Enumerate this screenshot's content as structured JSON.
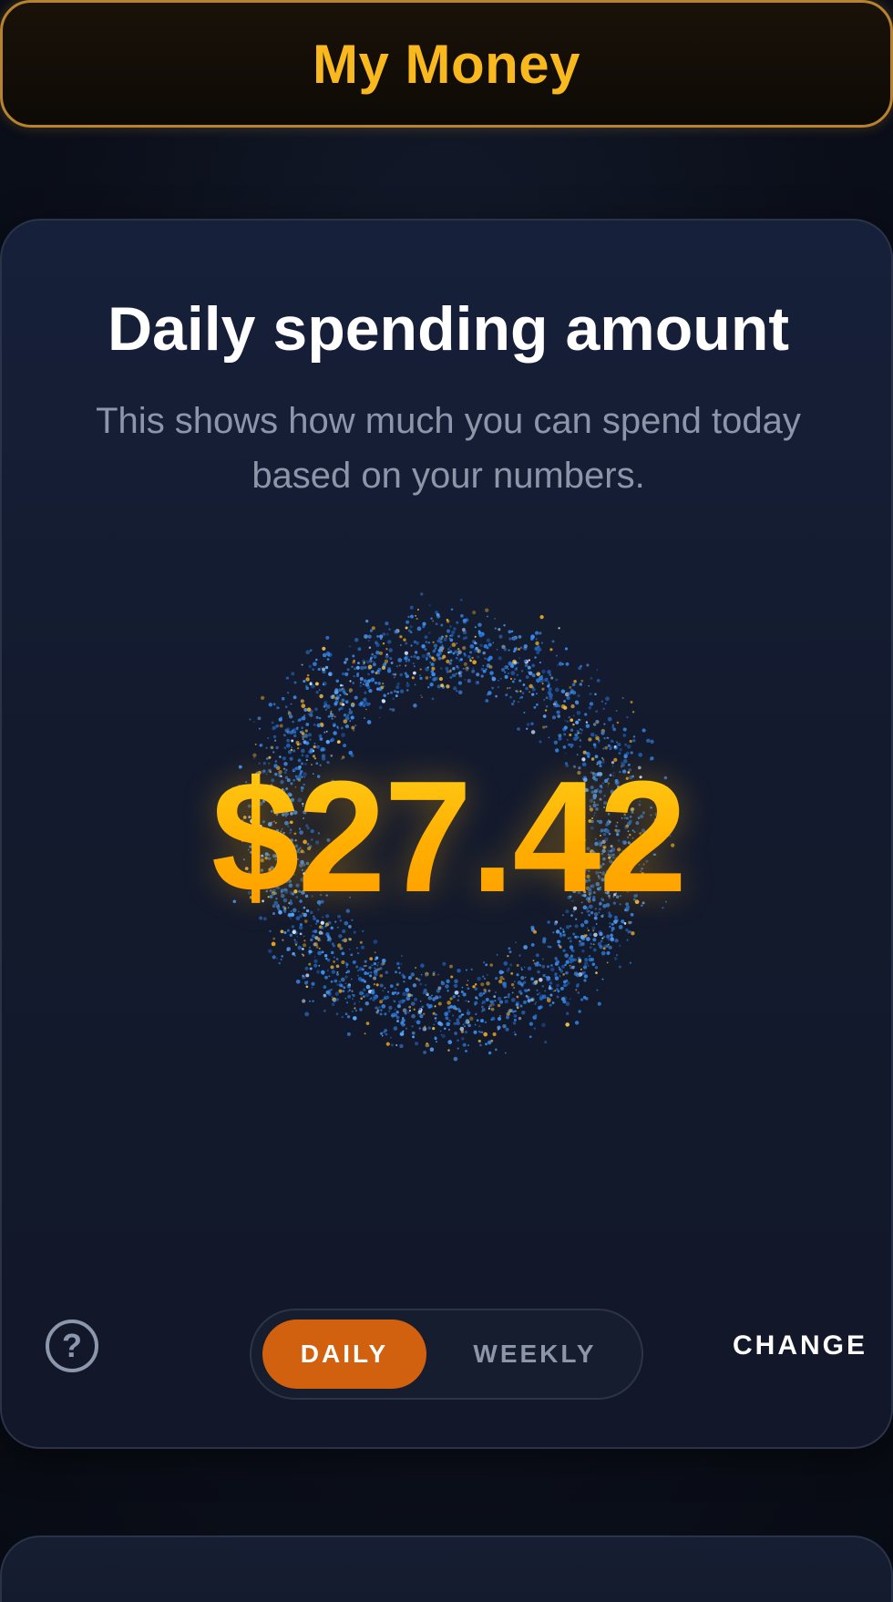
{
  "header": {
    "title": "My Money"
  },
  "spending_card": {
    "title": "Daily spending amount",
    "subtitle": "This shows how much you can spend today based on your numbers.",
    "amount": "$27.42",
    "help_icon": "question-circle-icon",
    "period_toggle": {
      "options": [
        "DAILY",
        "WEEKLY"
      ],
      "selected": "DAILY"
    },
    "change_label": "CHANGE"
  },
  "colors": {
    "accent_gold": "#f8b81e",
    "amount_gold": "#ffb400",
    "toggle_active": "#d2610f",
    "ring_blue": "#2f7fe0",
    "background": "#0b0f1a"
  }
}
